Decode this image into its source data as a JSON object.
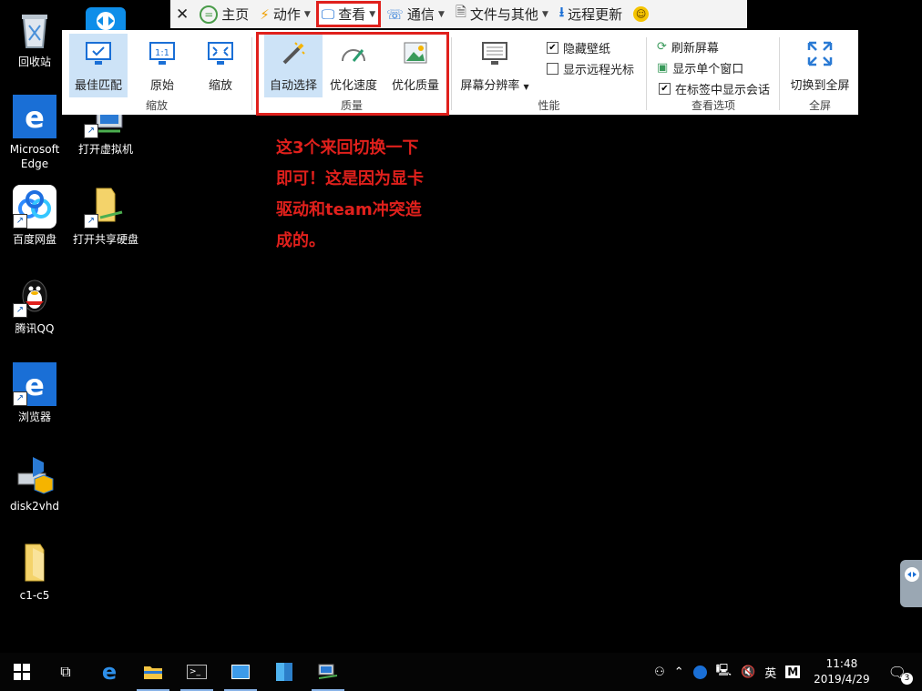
{
  "desktop": {
    "icons": [
      {
        "label": "回收站"
      },
      {
        "label": "Microsoft Edge"
      },
      {
        "label": "打开虚拟机"
      },
      {
        "label": "百度网盘"
      },
      {
        "label": "打开共享硬盘"
      },
      {
        "label": "腾讯QQ"
      },
      {
        "label": "浏览器"
      },
      {
        "label": "disk2vhd"
      },
      {
        "label": "c1-c5"
      }
    ]
  },
  "toolbar": {
    "items": [
      {
        "label": "主页",
        "icon": "home-icon"
      },
      {
        "label": "动作",
        "icon": "lightning-icon"
      },
      {
        "label": "查看",
        "icon": "monitor-icon"
      },
      {
        "label": "通信",
        "icon": "phone-icon"
      },
      {
        "label": "文件与其他",
        "icon": "file-icon"
      },
      {
        "label": "远程更新",
        "icon": "download-icon"
      }
    ]
  },
  "ribbon": {
    "groups": {
      "scale": {
        "label": "缩放",
        "buttons": [
          {
            "label": "最佳匹配"
          },
          {
            "label": "原始"
          },
          {
            "label": "缩放"
          }
        ]
      },
      "quality": {
        "label": "质量",
        "buttons": [
          {
            "label": "自动选择"
          },
          {
            "label": "优化速度"
          },
          {
            "label": "优化质量"
          }
        ]
      },
      "performance": {
        "label": "性能",
        "resolution_label": "屏幕分辨率",
        "checks": [
          {
            "label": "隐藏壁纸",
            "checked": true
          },
          {
            "label": "显示远程光标",
            "checked": false
          }
        ]
      },
      "view_options": {
        "label": "查看选项",
        "refresh": "刷新屏幕",
        "single_window": "显示单个窗口",
        "show_in_tabs": "在标签中显示会话",
        "show_in_tabs_checked": true
      },
      "fullscreen": {
        "label": "全屏",
        "button": "切换到全屏"
      }
    }
  },
  "annotation": {
    "lines": [
      "这3个来回切换一下",
      "即可！这是因为显卡",
      "驱动和team冲突造",
      "成的。"
    ]
  },
  "taskbar": {
    "tray": {
      "ime": "英",
      "ime2": "M",
      "time": "11:48",
      "date": "2019/4/29",
      "notifications": "3"
    }
  },
  "colors": {
    "accent_red": "#e0201c",
    "selected_bg": "#cde3f7",
    "brand_blue": "#1a6fd6"
  }
}
